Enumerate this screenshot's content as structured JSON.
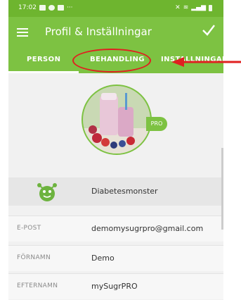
{
  "status_bar": {
    "time": "17:02"
  },
  "app_bar": {
    "title": "Profil & Inställningar"
  },
  "tabs": [
    {
      "label": "PERSON"
    },
    {
      "label": "BEHANDLING"
    },
    {
      "label": "INSTÄLLNINGAR"
    }
  ],
  "profile": {
    "badge": "PRO"
  },
  "monster": {
    "label": "Diabetesmonster"
  },
  "fields": [
    {
      "label": "E-POST",
      "value": "demomysugrpro@gmail.com"
    },
    {
      "label": "FÖRNAMN",
      "value": "Demo"
    },
    {
      "label": "EFTERNAMN",
      "value": "mySugrPRO"
    }
  ],
  "colors": {
    "appbar": "#7dc242",
    "annotation": "#e02020"
  }
}
